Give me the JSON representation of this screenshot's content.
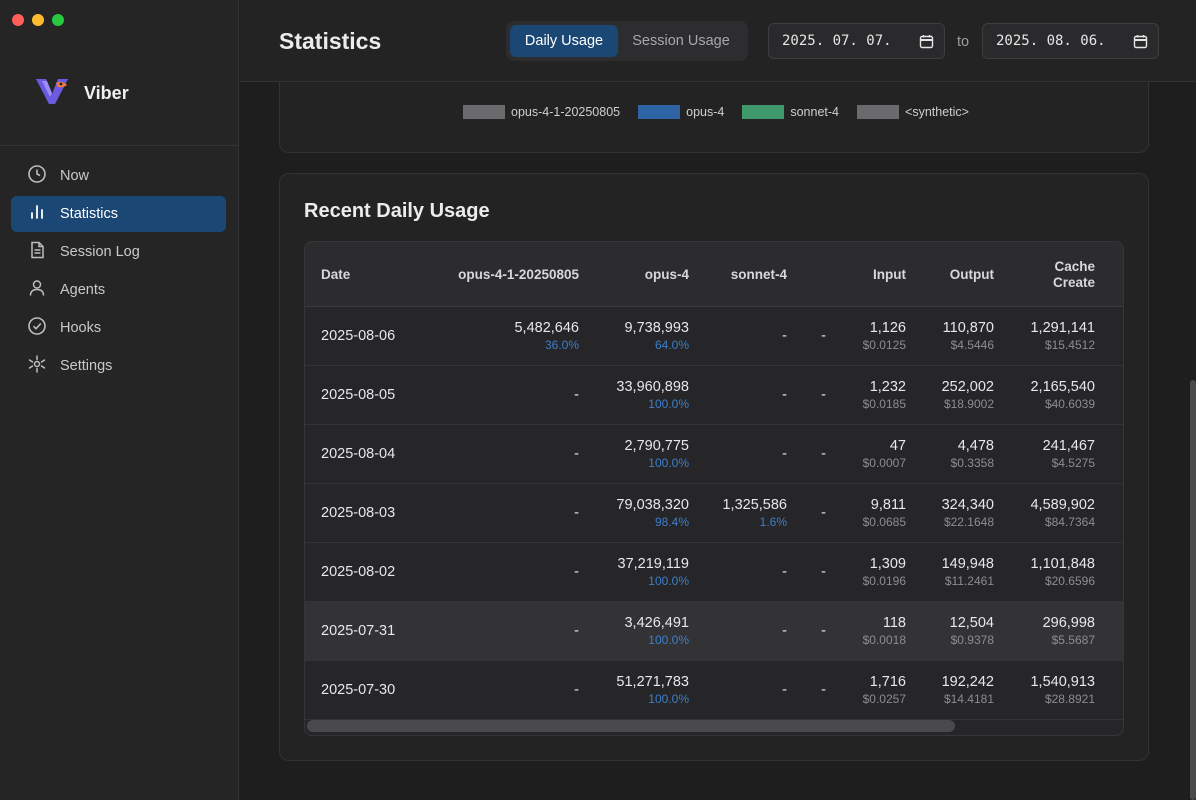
{
  "app": {
    "name": "Viber"
  },
  "sidebar": {
    "items": [
      {
        "label": "Now",
        "icon": "clock-icon",
        "active": false
      },
      {
        "label": "Statistics",
        "icon": "bar-chart-icon",
        "active": true
      },
      {
        "label": "Session Log",
        "icon": "document-icon",
        "active": false
      },
      {
        "label": "Agents",
        "icon": "person-icon",
        "active": false
      },
      {
        "label": "Hooks",
        "icon": "check-circle-icon",
        "active": false
      },
      {
        "label": "Settings",
        "icon": "settings-icon",
        "active": false
      }
    ]
  },
  "header": {
    "title": "Statistics",
    "tabs": [
      {
        "label": "Daily Usage",
        "active": true
      },
      {
        "label": "Session Usage",
        "active": false
      }
    ],
    "date_from": "2025. 07. 07.",
    "to_label": "to",
    "date_to": "2025. 08. 06."
  },
  "legend": {
    "items": [
      {
        "label": "opus-4-1-20250805",
        "color": "#6b6b6d"
      },
      {
        "label": "opus-4",
        "color": "#2e63a4"
      },
      {
        "label": "sonnet-4",
        "color": "#3e9a6c"
      },
      {
        "label": "<synthetic>",
        "color": "#6b6b6d"
      }
    ]
  },
  "usage": {
    "title": "Recent Daily Usage",
    "headers": {
      "date": "Date",
      "m1": "opus-4-1-20250805",
      "m2": "opus-4",
      "m3": "sonnet-4",
      "input": "Input",
      "output": "Output",
      "cache_create_1": "Cache",
      "cache_create_2": "Create"
    },
    "rows": [
      {
        "date": "2025-08-06",
        "m1": "5,482,646",
        "m1p": "36.0%",
        "m2": "9,738,993",
        "m2p": "64.0%",
        "m3": "-",
        "m3p": "",
        "syn": "-",
        "input": "1,126",
        "input_cost": "$0.0125",
        "output": "110,870",
        "output_cost": "$4.5446",
        "cc": "1,291,141",
        "cc_cost": "$15.4512"
      },
      {
        "date": "2025-08-05",
        "m1": "-",
        "m1p": "",
        "m2": "33,960,898",
        "m2p": "100.0%",
        "m3": "-",
        "m3p": "",
        "syn": "-",
        "input": "1,232",
        "input_cost": "$0.0185",
        "output": "252,002",
        "output_cost": "$18.9002",
        "cc": "2,165,540",
        "cc_cost": "$40.6039"
      },
      {
        "date": "2025-08-04",
        "m1": "-",
        "m1p": "",
        "m2": "2,790,775",
        "m2p": "100.0%",
        "m3": "-",
        "m3p": "",
        "syn": "-",
        "input": "47",
        "input_cost": "$0.0007",
        "output": "4,478",
        "output_cost": "$0.3358",
        "cc": "241,467",
        "cc_cost": "$4.5275"
      },
      {
        "date": "2025-08-03",
        "m1": "-",
        "m1p": "",
        "m2": "79,038,320",
        "m2p": "98.4%",
        "m3": "1,325,586",
        "m3p": "1.6%",
        "syn": "-",
        "input": "9,811",
        "input_cost": "$0.0685",
        "output": "324,340",
        "output_cost": "$22.1648",
        "cc": "4,589,902",
        "cc_cost": "$84.7364"
      },
      {
        "date": "2025-08-02",
        "m1": "-",
        "m1p": "",
        "m2": "37,219,119",
        "m2p": "100.0%",
        "m3": "-",
        "m3p": "",
        "syn": "-",
        "input": "1,309",
        "input_cost": "$0.0196",
        "output": "149,948",
        "output_cost": "$11.2461",
        "cc": "1,101,848",
        "cc_cost": "$20.6596"
      },
      {
        "date": "2025-07-31",
        "m1": "-",
        "m1p": "",
        "m2": "3,426,491",
        "m2p": "100.0%",
        "m3": "-",
        "m3p": "",
        "syn": "-",
        "input": "118",
        "input_cost": "$0.0018",
        "output": "12,504",
        "output_cost": "$0.9378",
        "cc": "296,998",
        "cc_cost": "$5.5687",
        "highlighted": true
      },
      {
        "date": "2025-07-30",
        "m1": "-",
        "m1p": "",
        "m2": "51,271,783",
        "m2p": "100.0%",
        "m3": "-",
        "m3p": "",
        "syn": "-",
        "input": "1,716",
        "input_cost": "$0.0257",
        "output": "192,242",
        "output_cost": "$14.4181",
        "cc": "1,540,913",
        "cc_cost": "$28.8921"
      }
    ]
  }
}
